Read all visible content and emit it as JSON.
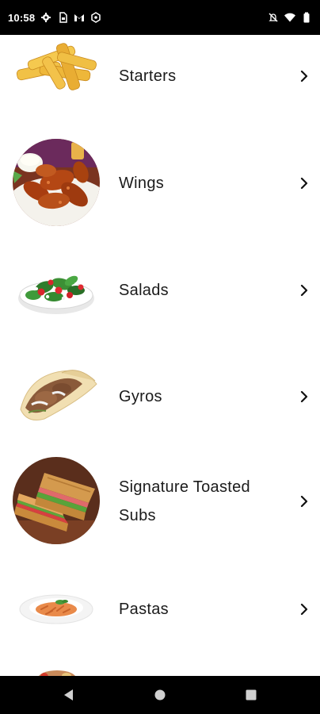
{
  "status_bar": {
    "time": "10:58",
    "left_icons": [
      "settings-icon",
      "sim-card-icon",
      "gmail-icon",
      "shield-icon"
    ],
    "right_icons": [
      "mute-icon",
      "wifi-icon",
      "battery-icon"
    ]
  },
  "categories": [
    {
      "label": "Starters",
      "icon": "fries-image"
    },
    {
      "label": "Wings",
      "icon": "wings-image"
    },
    {
      "label": "Salads",
      "icon": "salad-image"
    },
    {
      "label": "Gyros",
      "icon": "gyro-image"
    },
    {
      "label": "Signature Toasted Subs",
      "icon": "sub-sandwich-image"
    },
    {
      "label": "Pastas",
      "icon": "pasta-image"
    }
  ],
  "nav_bar": {
    "buttons": [
      "back-button",
      "home-button",
      "recents-button"
    ]
  },
  "colors": {
    "status_bar": "#000000",
    "background": "#ffffff",
    "text": "#1b1b1b"
  }
}
